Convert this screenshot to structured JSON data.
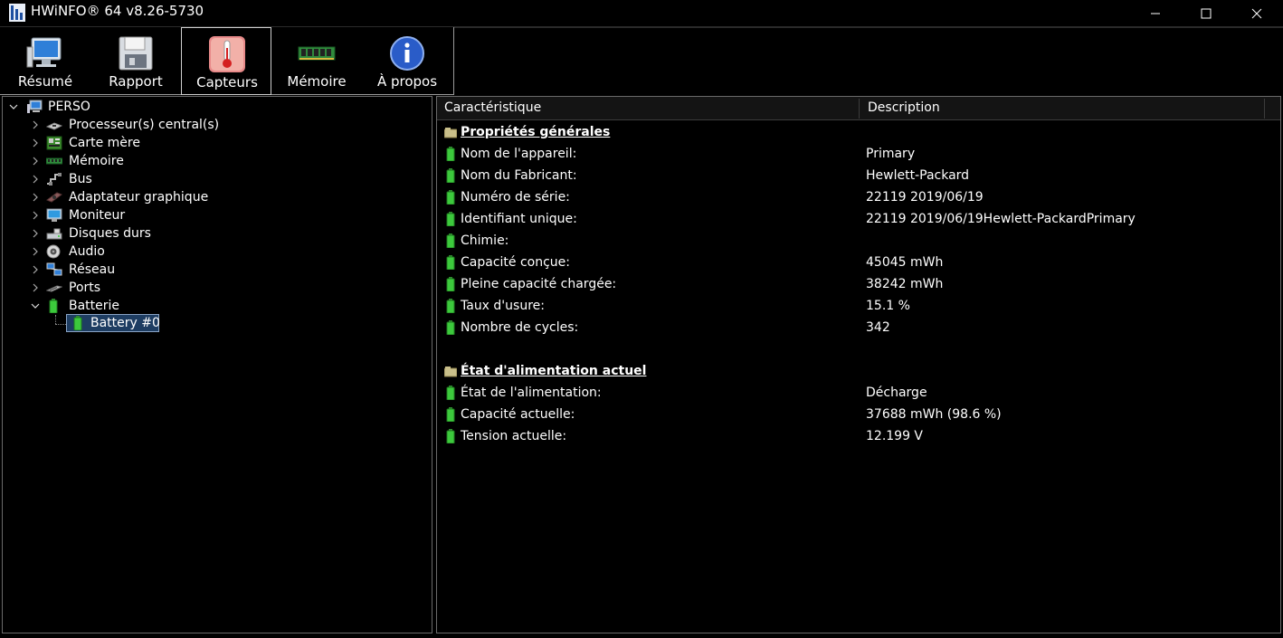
{
  "window": {
    "title": "HWiNFO® 64 v8.26-5730"
  },
  "toolbar": {
    "buttons": [
      {
        "label": "Résumé",
        "icon": "monitor-icon"
      },
      {
        "label": "Rapport",
        "icon": "floppy-disk-icon"
      },
      {
        "label": "Capteurs",
        "icon": "thermometer-icon",
        "active": true
      },
      {
        "label": "Mémoire",
        "icon": "ram-module-icon"
      },
      {
        "label": "À propos",
        "icon": "info-icon"
      }
    ]
  },
  "tree": {
    "root": {
      "label": "PERSO",
      "icon": "computer-icon"
    },
    "items": [
      {
        "label": "Processeur(s) central(s)",
        "icon": "cpu-icon"
      },
      {
        "label": "Carte mère",
        "icon": "motherboard-icon"
      },
      {
        "label": "Mémoire",
        "icon": "ram-module-icon"
      },
      {
        "label": "Bus",
        "icon": "bus-icon"
      },
      {
        "label": "Adaptateur graphique",
        "icon": "gpu-icon"
      },
      {
        "label": "Moniteur",
        "icon": "monitor-icon"
      },
      {
        "label": "Disques durs",
        "icon": "hard-disk-icon"
      },
      {
        "label": "Audio",
        "icon": "speaker-icon"
      },
      {
        "label": "Réseau",
        "icon": "network-icon"
      },
      {
        "label": "Ports",
        "icon": "port-icon"
      },
      {
        "label": "Batterie",
        "icon": "battery-icon"
      }
    ],
    "child": {
      "label": "Battery #0",
      "icon": "battery-icon"
    }
  },
  "list": {
    "headers": {
      "property": "Caractéristique",
      "value": "Description"
    },
    "sections": [
      {
        "title": "Propriétés générales",
        "rows": [
          {
            "property": "Nom de l'appareil:",
            "value": "Primary"
          },
          {
            "property": "Nom du Fabricant:",
            "value": "Hewlett-Packard"
          },
          {
            "property": "Numéro de série:",
            "value": "22119 2019/06/19"
          },
          {
            "property": "Identifiant unique:",
            "value": "22119 2019/06/19Hewlett-PackardPrimary"
          },
          {
            "property": "Chimie:",
            "value": ""
          },
          {
            "property": "Capacité conçue:",
            "value": "45045 mWh"
          },
          {
            "property": "Pleine capacité chargée:",
            "value": "38242 mWh"
          },
          {
            "property": "Taux d'usure:",
            "value": "15.1 %"
          },
          {
            "property": "Nombre de cycles:",
            "value": "342"
          }
        ]
      },
      {
        "title": "État d'alimentation actuel",
        "rows": [
          {
            "property": "État de l'alimentation:",
            "value": "Décharge"
          },
          {
            "property": "Capacité actuelle:",
            "value": "37688 mWh (98.6 %)"
          },
          {
            "property": "Tension actuelle:",
            "value": "12.199 V"
          }
        ]
      }
    ]
  },
  "colors": {
    "background": "#000000",
    "selection": "#1e3d62",
    "battery_green": "#3cc93c"
  }
}
